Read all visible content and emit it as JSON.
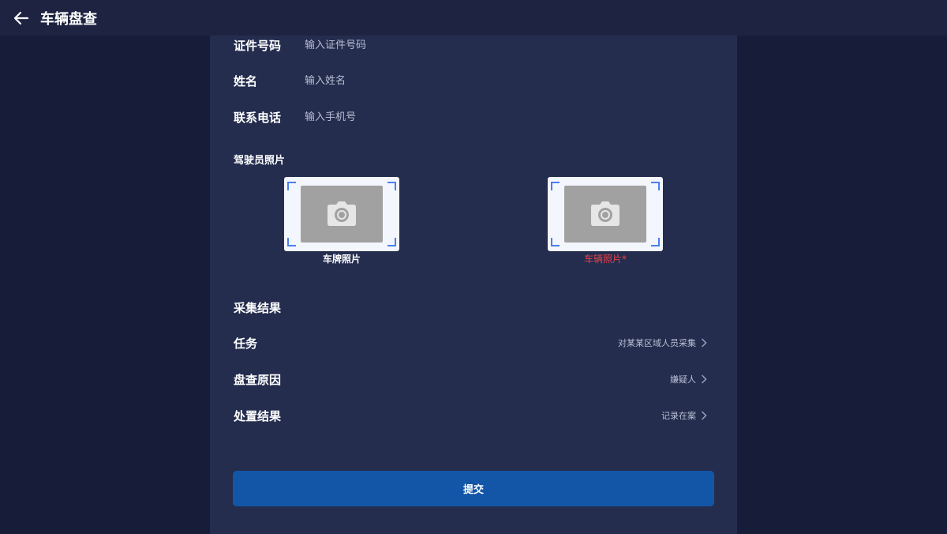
{
  "header": {
    "title": "车辆盘查",
    "back_icon": "arrow-left-icon"
  },
  "form": {
    "id_number": {
      "label": "证件号码",
      "placeholder": "输入证件号码",
      "value": ""
    },
    "name": {
      "label": "姓名",
      "placeholder": "输入姓名",
      "value": ""
    },
    "phone": {
      "label": "联系电话",
      "placeholder": "输入手机号",
      "value": ""
    }
  },
  "photos": {
    "section_label": "驾驶员照片",
    "plate_photo": {
      "caption": "车牌照片",
      "icon": "camera-icon",
      "caption_color": "#ffffff"
    },
    "vehicle_photo": {
      "caption": "车辆照片*",
      "icon": "camera-icon",
      "caption_color": "#e8424a"
    }
  },
  "result": {
    "section_label": "采集结果",
    "task": {
      "label": "任务",
      "value": "对某某区域人员采集"
    },
    "reason": {
      "label": "盘查原因",
      "value": "嫌疑人"
    },
    "disposal": {
      "label": "处置结果",
      "value": "记录在案"
    }
  },
  "submit": {
    "label": "提交"
  },
  "colors": {
    "background": "#171c38",
    "panel": "#242d4e",
    "topbar": "#1d2341",
    "accent": "#1356a8",
    "required": "#e8424a",
    "corner": "#4a7ef0"
  }
}
